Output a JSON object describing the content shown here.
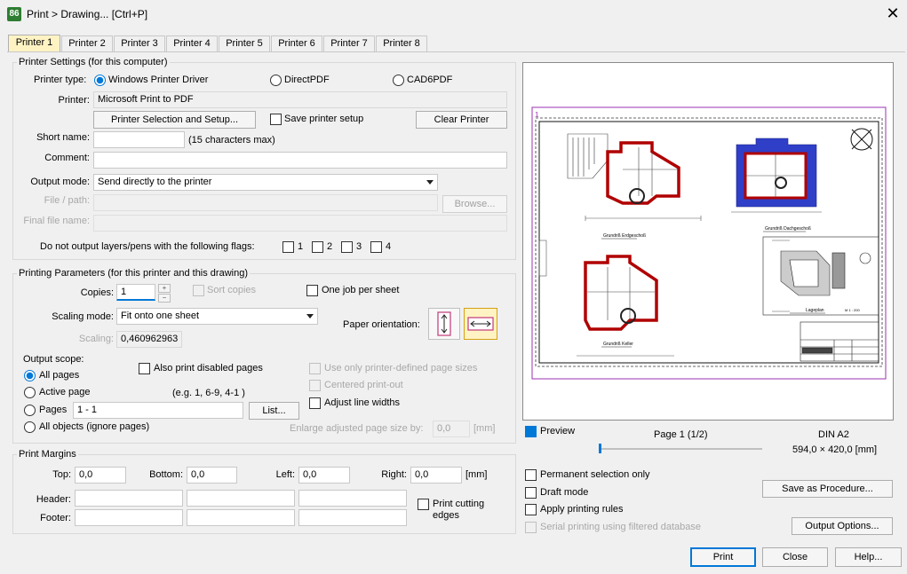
{
  "window": {
    "app_icon_text": "86",
    "title": "Print > Drawing... [Ctrl+P]"
  },
  "tabs": [
    "Printer 1",
    "Printer 2",
    "Printer 3",
    "Printer 4",
    "Printer 5",
    "Printer 6",
    "Printer 7",
    "Printer 8"
  ],
  "printer_settings": {
    "title": "Printer Settings (for this computer)",
    "printer_type_label": "Printer type:",
    "type_windows": "Windows Printer Driver",
    "type_directpdf": "DirectPDF",
    "type_cad6pdf": "CAD6PDF",
    "printer_label": "Printer:",
    "printer_value": "Microsoft Print to PDF",
    "selection_button": "Printer Selection and Setup...",
    "save_setup_label": "Save printer setup",
    "clear_button": "Clear Printer",
    "short_name_label": "Short name:",
    "short_name_value": "",
    "short_name_hint": "(15 characters max)",
    "comment_label": "Comment:",
    "comment_value": "",
    "output_mode_label": "Output mode:",
    "output_mode_value": "Send directly to the printer",
    "file_path_label": "File / path:",
    "browse_button": "Browse...",
    "final_file_label": "Final file name:",
    "flags_label": "Do not output layers/pens with the following flags:",
    "flags": [
      "1",
      "2",
      "3",
      "4"
    ]
  },
  "printing_params": {
    "title": "Printing Parameters (for this printer and this drawing)",
    "copies_label": "Copies:",
    "copies_value": "1",
    "sort_copies_label": "Sort copies",
    "one_job_label": "One job per sheet",
    "scaling_mode_label": "Scaling mode:",
    "scaling_mode_value": "Fit onto one sheet",
    "scaling_label": "Scaling:",
    "scaling_value": "0,460962963",
    "paper_orientation_label": "Paper orientation:",
    "output_scope_label": "Output scope:",
    "scope_all": "All pages",
    "scope_active": "Active page",
    "scope_pages": "Pages",
    "pages_value": "1 - 1",
    "pages_hint": "(e.g. 1, 6-9, 4-1 )",
    "list_button": "List...",
    "scope_all_objects": "All objects (ignore pages)",
    "also_disabled_label": "Also print disabled pages",
    "use_printer_sizes_label": "Use only printer-defined page sizes",
    "centered_label": "Centered print-out",
    "adjust_widths_label": "Adjust line widths",
    "enlarge_label": "Enlarge adjusted page size by:",
    "enlarge_value": "0,0",
    "enlarge_unit": "[mm]"
  },
  "margins": {
    "title": "Print Margins",
    "top_label": "Top:",
    "top_value": "0,0",
    "bottom_label": "Bottom:",
    "bottom_value": "0,0",
    "left_label": "Left:",
    "left_value": "0,0",
    "right_label": "Right:",
    "right_value": "0,0",
    "unit": "[mm]",
    "header_label": "Header:",
    "footer_label": "Footer:",
    "cutting_edges_label": "Print cutting edges"
  },
  "preview": {
    "preview_label": "Preview",
    "page_label": "Page 1 (1/2)",
    "paper_name": "DIN A2",
    "paper_size": "594,0 × 420,0 [mm]",
    "page_marker": "1",
    "sheet_1_label": "Grundriß Erdgeschoß",
    "sheet_2_label": "Grundriß Dachgeschoß",
    "sheet_3_label": "Grundriß Keller",
    "sheet_4_label": "Lageplan",
    "sheet_4_scale": "M 1 : 200"
  },
  "options": {
    "permanent_label": "Permanent selection only",
    "draft_label": "Draft mode",
    "apply_rules_label": "Apply printing rules",
    "serial_label": "Serial printing using filtered database",
    "save_procedure_button": "Save as Procedure...",
    "output_options_button": "Output Options..."
  },
  "footer_buttons": {
    "print": "Print",
    "close": "Close",
    "help": "Help..."
  }
}
